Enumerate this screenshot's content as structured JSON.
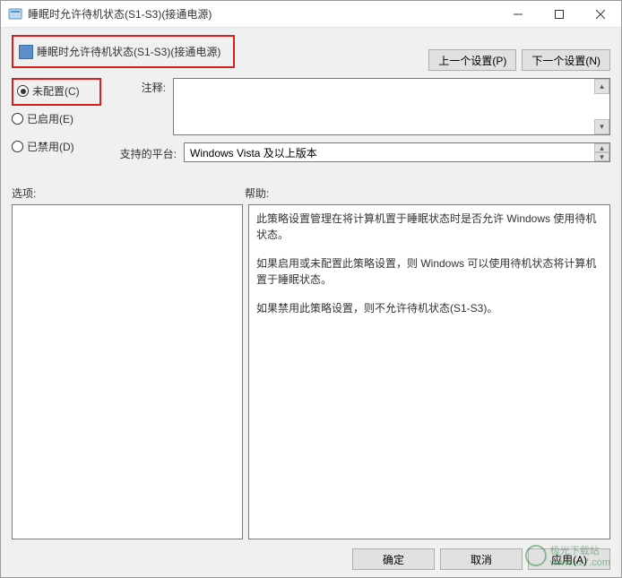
{
  "window": {
    "title": "睡眠时允许待机状态(S1-S3)(接通电源)"
  },
  "header": {
    "setting_title": "睡眠时允许待机状态(S1-S3)(接通电源)",
    "prev_btn": "上一个设置(P)",
    "next_btn": "下一个设置(N)"
  },
  "radios": {
    "not_configured": "未配置(C)",
    "enabled": "已启用(E)",
    "disabled": "已禁用(D)"
  },
  "labels": {
    "comment": "注释:",
    "platform": "支持的平台:",
    "options": "选项:",
    "help": "帮助:"
  },
  "fields": {
    "comment_value": "",
    "platform_value": "Windows Vista 及以上版本"
  },
  "help": {
    "p1": "此策略设置管理在将计算机置于睡眠状态时是否允许 Windows 使用待机状态。",
    "p2": "如果启用或未配置此策略设置，则 Windows 可以使用待机状态将计算机置于睡眠状态。",
    "p3": "如果禁用此策略设置，则不允许待机状态(S1-S3)。"
  },
  "footer": {
    "ok": "确定",
    "cancel": "取消",
    "apply": "应用(A)"
  },
  "watermark": {
    "name": "极光下载站",
    "url": "www.xz7.com"
  }
}
